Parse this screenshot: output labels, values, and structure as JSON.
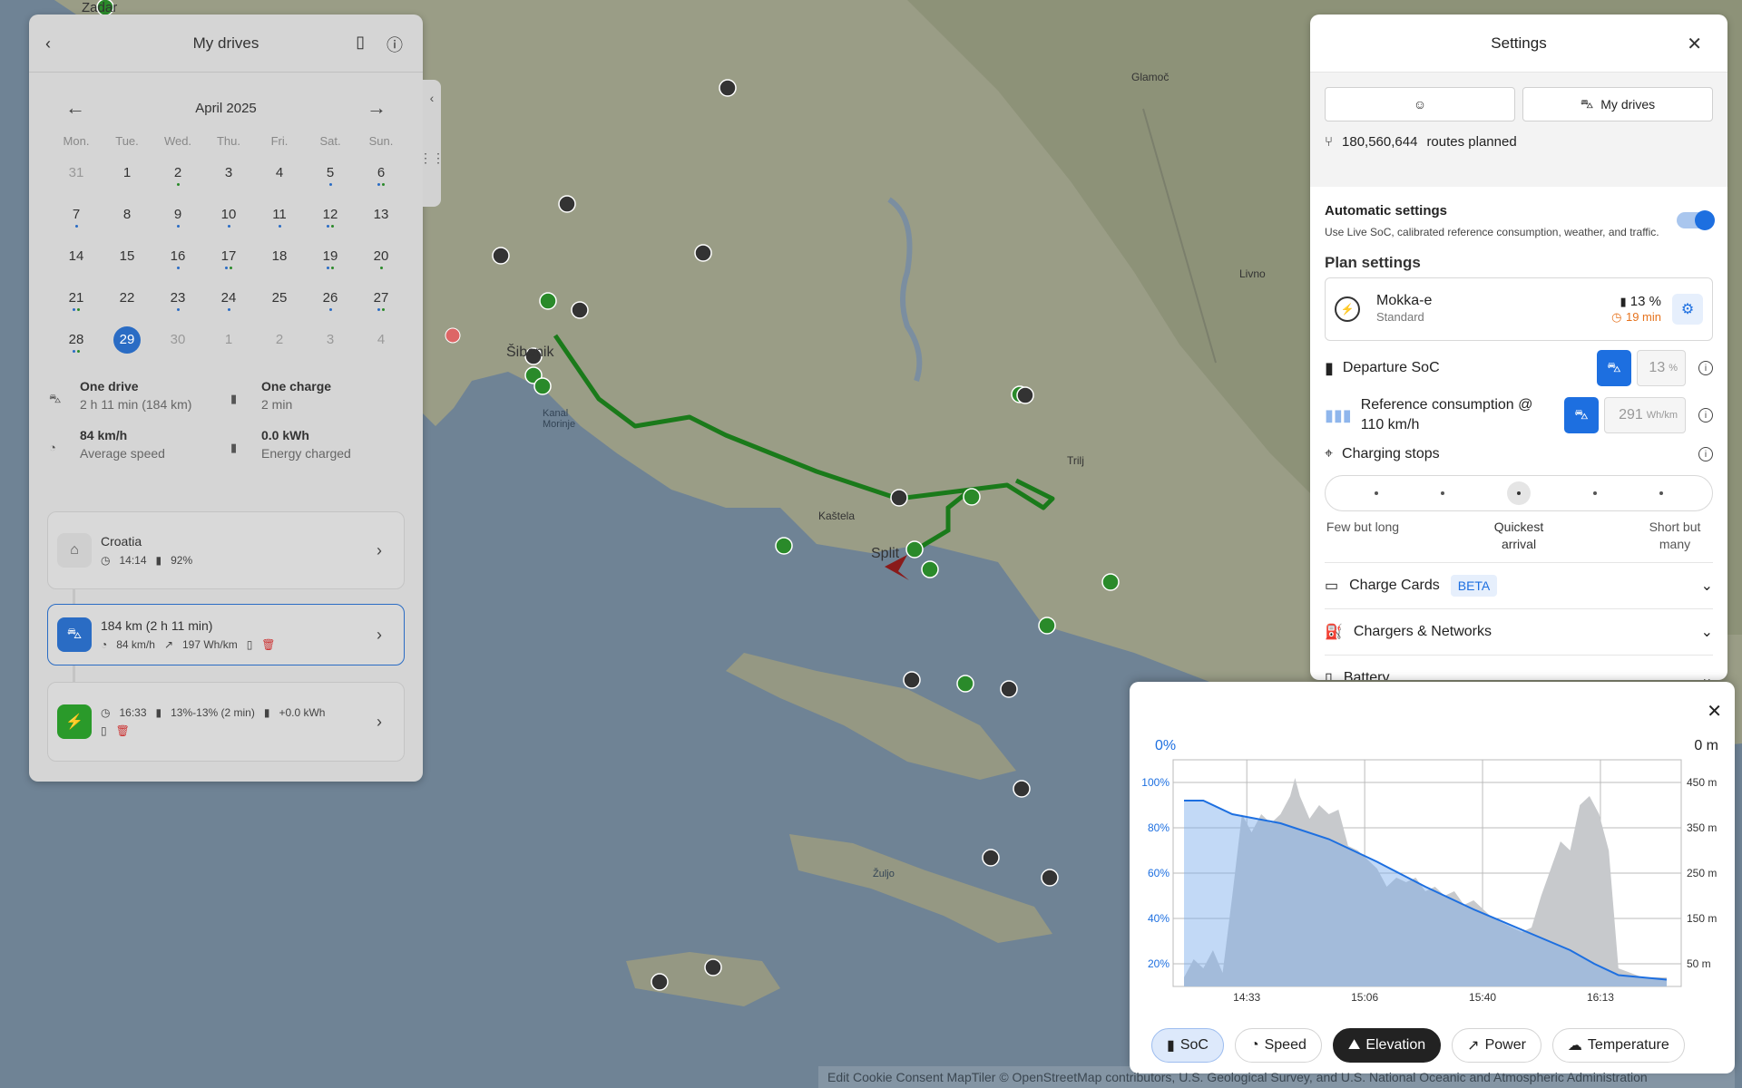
{
  "map": {
    "labels": [
      "Zadar",
      "Šibenik",
      "Kanal Morinje",
      "Kaštela",
      "Split",
      "Glamoč",
      "Livno",
      "Trilj",
      "Žuljo"
    ],
    "route_color": "#1a7a1a"
  },
  "drives": {
    "title": "My drives",
    "month": "April 2025",
    "weekdays": [
      "Mon.",
      "Tue.",
      "Wed.",
      "Thu.",
      "Fri.",
      "Sat.",
      "Sun."
    ],
    "days": [
      {
        "n": "31",
        "muted": true,
        "dots": []
      },
      {
        "n": "1",
        "dots": []
      },
      {
        "n": "2",
        "dots": [
          "#2a8a2a"
        ]
      },
      {
        "n": "3",
        "dots": []
      },
      {
        "n": "4",
        "dots": []
      },
      {
        "n": "5",
        "dots": [
          "#2a6cc4"
        ]
      },
      {
        "n": "6",
        "dots": [
          "#2a6cc4",
          "#2a8a2a"
        ]
      },
      {
        "n": "7",
        "dots": [
          "#2a6cc4"
        ]
      },
      {
        "n": "8",
        "dots": []
      },
      {
        "n": "9",
        "dots": [
          "#2a6cc4"
        ]
      },
      {
        "n": "10",
        "dots": [
          "#2a6cc4"
        ]
      },
      {
        "n": "11",
        "dots": [
          "#2a6cc4"
        ]
      },
      {
        "n": "12",
        "dots": [
          "#2a6cc4",
          "#2a8a2a"
        ]
      },
      {
        "n": "13",
        "dots": []
      },
      {
        "n": "14",
        "dots": []
      },
      {
        "n": "15",
        "dots": []
      },
      {
        "n": "16",
        "dots": [
          "#2a6cc4"
        ]
      },
      {
        "n": "17",
        "dots": [
          "#2a6cc4",
          "#2a8a2a"
        ]
      },
      {
        "n": "18",
        "dots": []
      },
      {
        "n": "19",
        "dots": [
          "#2a6cc4",
          "#2a8a2a"
        ]
      },
      {
        "n": "20",
        "dots": [
          "#2a8a2a"
        ]
      },
      {
        "n": "21",
        "dots": [
          "#2a6cc4",
          "#2a8a2a"
        ]
      },
      {
        "n": "22",
        "dots": []
      },
      {
        "n": "23",
        "dots": [
          "#2a6cc4"
        ]
      },
      {
        "n": "24",
        "dots": [
          "#2a6cc4"
        ]
      },
      {
        "n": "25",
        "dots": []
      },
      {
        "n": "26",
        "dots": [
          "#2a6cc4"
        ]
      },
      {
        "n": "27",
        "dots": [
          "#2a6cc4",
          "#2a8a2a"
        ]
      },
      {
        "n": "28",
        "dots": [
          "#2a6cc4",
          "#2a8a2a"
        ]
      },
      {
        "n": "29",
        "selected": true,
        "dots": []
      },
      {
        "n": "30",
        "muted": true,
        "dots": []
      },
      {
        "n": "1",
        "muted": true,
        "dots": []
      },
      {
        "n": "2",
        "muted": true,
        "dots": []
      },
      {
        "n": "3",
        "muted": true,
        "dots": []
      },
      {
        "n": "4",
        "muted": true,
        "dots": []
      }
    ],
    "stats": {
      "drive_title": "One drive",
      "drive_sub": "2 h 11 min (184 km)",
      "charge_title": "One charge",
      "charge_sub": "2 min",
      "speed_title": "84 km/h",
      "speed_sub": "Average speed",
      "energy_title": "0.0 kWh",
      "energy_sub": "Energy charged"
    },
    "cards": {
      "origin": {
        "title": "Croatia",
        "time": "14:14",
        "soc": "92%"
      },
      "drive": {
        "title": "184 km (2 h 11 min)",
        "speed": "84 km/h",
        "consumption": "197 Wh/km",
        "color": "#2a6cc4"
      },
      "charge": {
        "time": "16:33",
        "soc": "13%-13% (2 min)",
        "energy": "+0.0 kWh",
        "color": "#2a9a2a"
      }
    }
  },
  "settings": {
    "title": "Settings",
    "tab_drives": "My drives",
    "routes_count": "180,560,644",
    "routes_label": "routes planned",
    "auto_title": "Automatic settings",
    "auto_desc": "Use Live SoC, calibrated reference consumption, weather, and traffic.",
    "auto_enabled": true,
    "plan_title": "Plan settings",
    "car_name": "Mokka-e",
    "car_trim": "Standard",
    "car_soc": "13 %",
    "car_time": "19 min",
    "departure_label": "Departure SoC",
    "departure_value": "13",
    "departure_unit": "%",
    "refcons_label": "Reference consumption @ 110 km/h",
    "refcons_value": "291",
    "refcons_unit": "Wh/km",
    "stops_label": "Charging stops",
    "stops_options": [
      "Few but long",
      "",
      "Quickest arrival",
      "",
      "Short but many"
    ],
    "stops_selected": 2,
    "charge_cards": "Charge Cards",
    "beta": "BETA",
    "chargers": "Chargers & Networks",
    "battery": "Battery",
    "accent": "#1d6fe0"
  },
  "chart": {
    "top_left": "0%",
    "top_right": "0 m",
    "buttons": [
      "SoC",
      "Speed",
      "Elevation",
      "Power",
      "Temperature"
    ],
    "active_buttons": [
      "SoC",
      "Elevation"
    ]
  },
  "chart_data": {
    "type": "area",
    "x_ticks": [
      "14:33",
      "15:06",
      "15:40",
      "16:13"
    ],
    "y_left_ticks": [
      "100%",
      "80%",
      "60%",
      "40%",
      "20%"
    ],
    "y_right_ticks": [
      "450 m",
      "350 m",
      "250 m",
      "150 m",
      "50 m"
    ],
    "ylim_left": [
      10,
      110
    ],
    "ylim_right": [
      0,
      500
    ],
    "series": [
      {
        "name": "SoC",
        "unit": "%",
        "x": [
          0,
          0.04,
          0.1,
          0.2,
          0.3,
          0.4,
          0.5,
          0.6,
          0.7,
          0.8,
          0.85,
          0.9,
          0.95,
          1.0
        ],
        "values": [
          92,
          92,
          86,
          82,
          75,
          65,
          54,
          44,
          35,
          26,
          20,
          15,
          14,
          13
        ]
      },
      {
        "name": "Elevation",
        "unit": "m",
        "x": [
          0,
          0.02,
          0.04,
          0.06,
          0.08,
          0.1,
          0.12,
          0.14,
          0.16,
          0.18,
          0.2,
          0.22,
          0.23,
          0.24,
          0.26,
          0.28,
          0.3,
          0.32,
          0.34,
          0.36,
          0.38,
          0.4,
          0.42,
          0.44,
          0.46,
          0.48,
          0.5,
          0.52,
          0.54,
          0.56,
          0.58,
          0.6,
          0.62,
          0.64,
          0.66,
          0.68,
          0.7,
          0.72,
          0.74,
          0.76,
          0.78,
          0.8,
          0.82,
          0.84,
          0.86,
          0.88,
          0.9,
          0.95,
          1.0
        ],
        "values": [
          20,
          60,
          40,
          80,
          30,
          200,
          380,
          340,
          380,
          360,
          380,
          420,
          460,
          420,
          370,
          400,
          380,
          390,
          310,
          300,
          280,
          260,
          220,
          240,
          230,
          240,
          210,
          220,
          200,
          210,
          180,
          190,
          170,
          150,
          140,
          130,
          120,
          130,
          200,
          260,
          320,
          300,
          400,
          420,
          380,
          300,
          40,
          20,
          20
        ]
      }
    ]
  },
  "attribution": "Edit Cookie Consent  MapTiler  © OpenStreetMap contributors, U.S. Geological Survey, and U.S. National Oceanic and Atmospheric Administration"
}
